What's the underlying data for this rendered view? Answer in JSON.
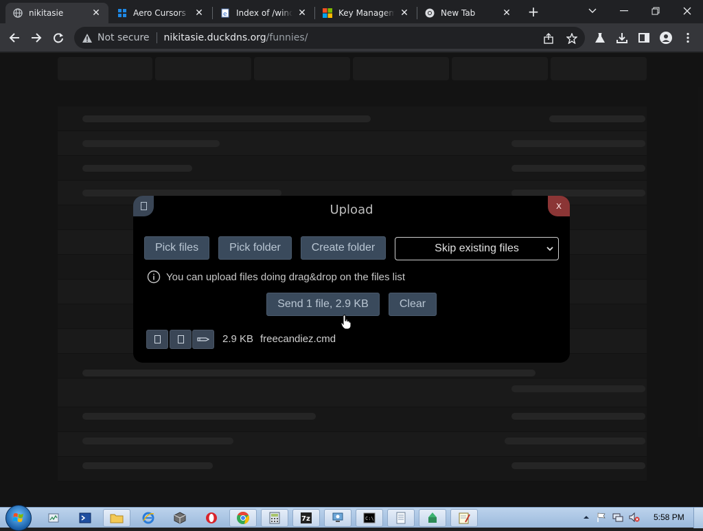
{
  "tabs": [
    {
      "title": "nikitasie",
      "icon": "globe-icon",
      "active": true
    },
    {
      "title": "Aero Cursors – W",
      "icon": "winaero-icon"
    },
    {
      "title": "Index of /windo",
      "icon": "ie-page-icon"
    },
    {
      "title": "Key Managemen",
      "icon": "microsoft-icon"
    },
    {
      "title": "New Tab",
      "icon": "chrome-icon"
    }
  ],
  "omnibox": {
    "security": "Not secure",
    "host": "nikitasie.duckdns.org",
    "path": "/funnies/"
  },
  "modal": {
    "title": "Upload",
    "close": "x",
    "buttons": {
      "pick_files": "Pick files",
      "pick_folder": "Pick folder",
      "create_folder": "Create folder",
      "send": "Send 1 file, 2.9 KB",
      "clear": "Clear"
    },
    "mode_select": "Skip existing files",
    "hint": "You can upload files doing drag&drop on the files list",
    "file": {
      "size": "2.9 KB",
      "name": "freecandiez.cmd",
      "action_icons": [
        "file-icon",
        "file-icon",
        "pencil-icon"
      ]
    }
  },
  "taskbar": {
    "clock": "5:58 PM"
  },
  "colors": {
    "modal_bg": "#000000",
    "button_bg": "#3a4a5c",
    "close_bg": "#8b3535"
  }
}
